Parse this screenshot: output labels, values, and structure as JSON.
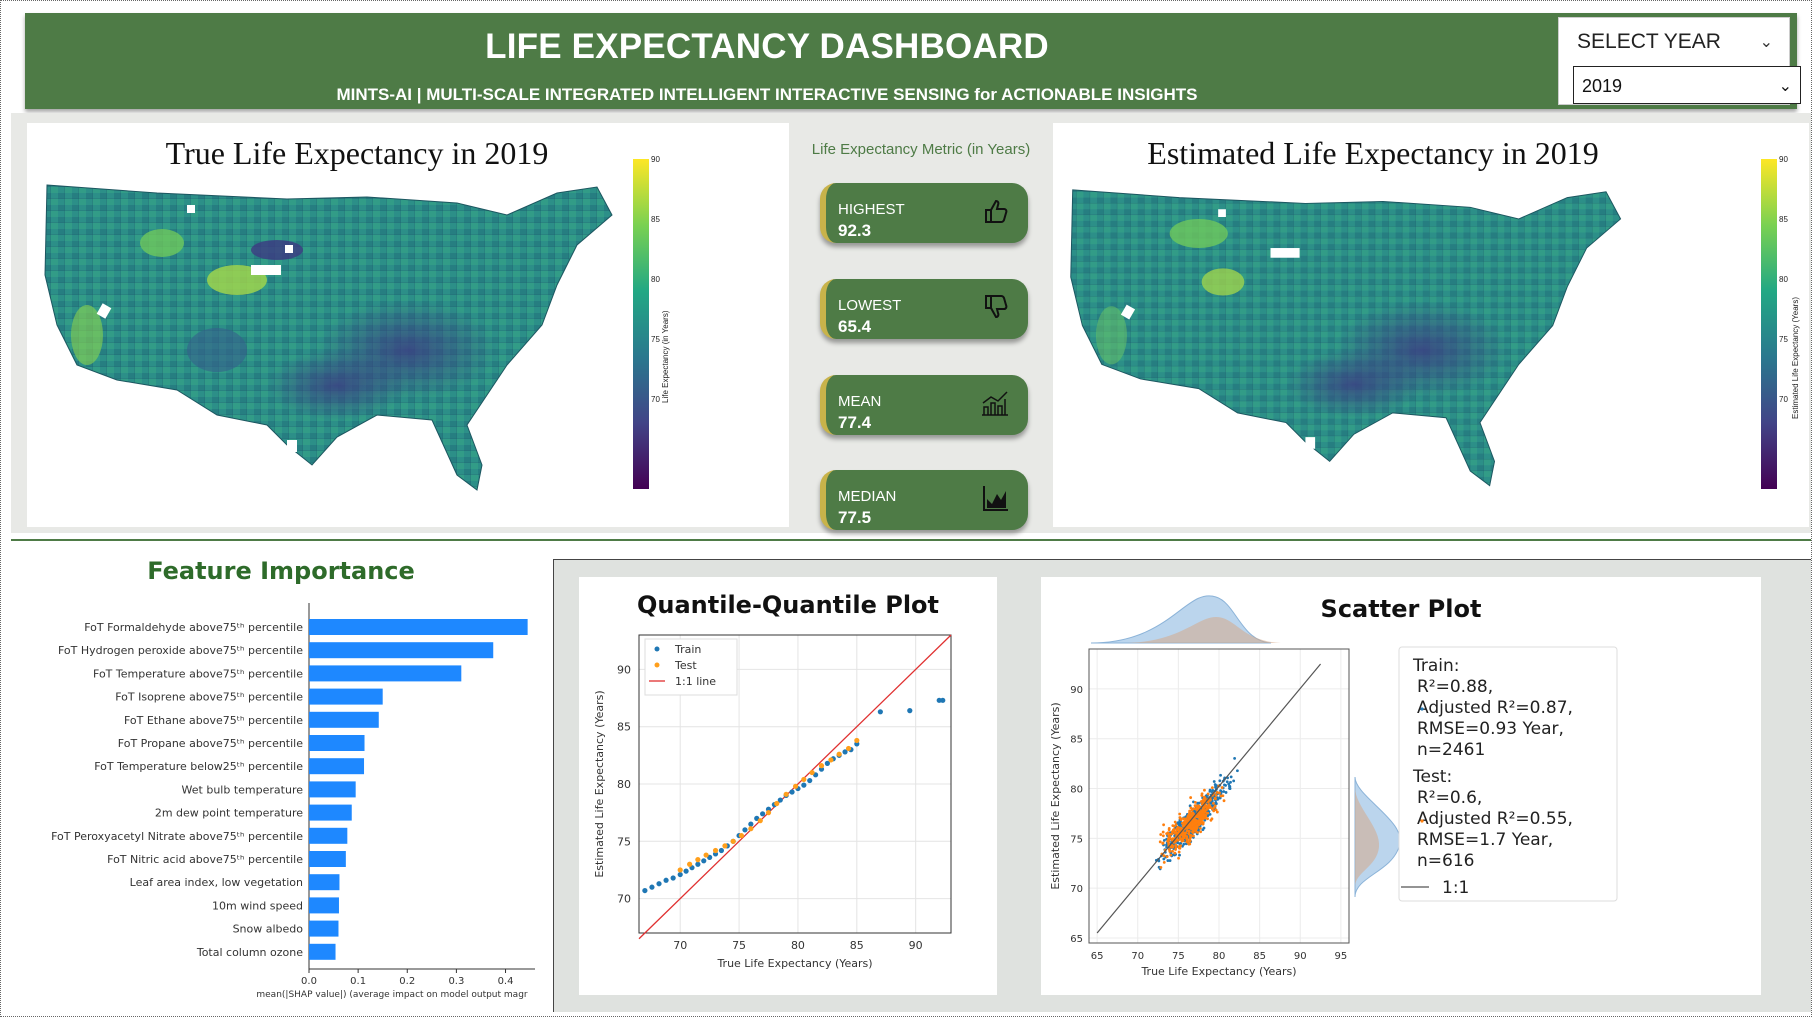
{
  "header": {
    "title": "LIFE EXPECTANCY DASHBOARD",
    "subtitle": "MINTS-AI | MULTI-SCALE INTEGRATED INTELLIGENT INTERACTIVE SENSING for ACTIONABLE INSIGHTS"
  },
  "year_filter": {
    "label": "SELECT YEAR",
    "selected": "2019"
  },
  "maps": {
    "true_title": "True Life Expectancy in 2019",
    "true_cbar_label": "Life Expectancy (in Years)",
    "est_title": "Estimated Life Expectancy in 2019",
    "est_cbar_label": "Estimated Life Expectancy (Years)",
    "cbar_ticks": [
      "90",
      "85",
      "80",
      "75",
      "70"
    ]
  },
  "metrics": {
    "title": "Life Expectancy Metric (in Years)",
    "items": [
      {
        "label": "HIGHEST",
        "value": "92.3",
        "icon": "thumbs-up-icon"
      },
      {
        "label": "LOWEST",
        "value": "65.4",
        "icon": "thumbs-down-icon"
      },
      {
        "label": "MEAN",
        "value": "77.4",
        "icon": "bar-trend-icon"
      },
      {
        "label": "MEDIAN",
        "value": "77.5",
        "icon": "area-chart-icon"
      }
    ]
  },
  "feature_importance": {
    "title": "Feature Importance",
    "chart_data": {
      "type": "bar",
      "orientation": "horizontal",
      "categories": [
        "FoT Formaldehyde above75ᵗʰ percentile",
        "FoT Hydrogen peroxide above75ᵗʰ percentile",
        "FoT Temperature above75ᵗʰ percentile",
        "FoT Isoprene above75ᵗʰ percentile",
        "FoT Ethane above75ᵗʰ percentile",
        "FoT Propane above75ᵗʰ percentile",
        "FoT Temperature below25ᵗʰ percentile",
        "Wet bulb temperature",
        "2m dew point temperature",
        "FoT Peroxyacetyl Nitrate above75ᵗʰ percentile",
        "FoT Nitric acid above75ᵗʰ percentile",
        "Leaf area index, low vegetation",
        "10m wind speed",
        "Snow albedo",
        "Total column ozone"
      ],
      "values": [
        0.445,
        0.375,
        0.31,
        0.15,
        0.142,
        0.113,
        0.112,
        0.095,
        0.087,
        0.078,
        0.075,
        0.062,
        0.061,
        0.06,
        0.054
      ],
      "xticks": [
        "0.0",
        "0.1",
        "0.2",
        "0.3",
        "0.4"
      ],
      "xlim": [
        0,
        0.46
      ],
      "xlabel": "mean(|SHAP value|) (average impact on model output magr",
      "color": "#1e88ff"
    }
  },
  "qq_plot": {
    "title": "Quantile-Quantile Plot",
    "chart_data": {
      "type": "scatter",
      "xlabel": "True Life Expectancy (Years)",
      "ylabel": "Estimated Life Expectancy (Years)",
      "xlim": [
        66.5,
        93
      ],
      "ylim": [
        67,
        93
      ],
      "xticks": [
        "70",
        "75",
        "80",
        "85",
        "90"
      ],
      "yticks": [
        "70",
        "75",
        "80",
        "85",
        "90"
      ],
      "legend": [
        "Train",
        "Test",
        "1:1 line"
      ],
      "series": [
        {
          "name": "Train",
          "color": "#1f77b4",
          "x": [
            67.0,
            67.6,
            68.2,
            68.8,
            69.4,
            70.0,
            70.5,
            71.0,
            71.5,
            72.0,
            72.5,
            73.0,
            73.5,
            74.0,
            74.5,
            75.0,
            75.5,
            76.0,
            76.5,
            77.0,
            77.5,
            78.0,
            78.5,
            79.0,
            79.5,
            80.0,
            80.5,
            81.0,
            81.5,
            82.0,
            82.5,
            83.0,
            83.5,
            84.0,
            84.5,
            85.0,
            87.0,
            89.5,
            92.0,
            92.3
          ],
          "y": [
            70.7,
            71.0,
            71.3,
            71.6,
            71.8,
            72.1,
            72.4,
            72.7,
            73.0,
            73.3,
            73.6,
            73.9,
            74.2,
            74.6,
            75.0,
            75.5,
            76.0,
            76.5,
            77.0,
            77.4,
            77.8,
            78.2,
            78.6,
            79.0,
            79.3,
            79.6,
            79.9,
            80.3,
            80.8,
            81.3,
            81.8,
            82.2,
            82.5,
            82.8,
            83.0,
            83.5,
            86.3,
            86.4,
            87.3,
            87.3
          ]
        },
        {
          "name": "Test",
          "color": "#ff9f1c",
          "x": [
            70.0,
            70.8,
            71.5,
            72.2,
            73.0,
            73.8,
            74.5,
            75.2,
            76.0,
            76.8,
            77.5,
            78.2,
            79.0,
            79.8,
            80.5,
            81.2,
            82.0,
            82.8,
            83.5,
            84.3,
            85.0
          ],
          "y": [
            72.5,
            73.0,
            73.4,
            73.8,
            74.2,
            74.6,
            75.0,
            75.5,
            76.1,
            76.8,
            77.5,
            78.3,
            79.1,
            79.8,
            80.4,
            81.0,
            81.6,
            82.1,
            82.6,
            83.1,
            83.8
          ]
        }
      ]
    }
  },
  "scatter_plot": {
    "title": "Scatter Plot",
    "chart_data": {
      "type": "scatter",
      "xlabel": "True Life Expectancy (Years)",
      "ylabel": "Estimated Life Expectancy (Years)",
      "xlim": [
        64,
        96
      ],
      "ylim": [
        64.5,
        94
      ],
      "xticks": [
        "65",
        "70",
        "75",
        "80",
        "85",
        "90",
        "95"
      ],
      "yticks": [
        "65",
        "70",
        "75",
        "80",
        "85",
        "90"
      ],
      "series": [
        {
          "name": "Train",
          "color": "#1f77b4"
        },
        {
          "name": "Test",
          "color": "#ff7f0e"
        }
      ]
    },
    "legend": {
      "train_lines": [
        "Train:",
        "R²=0.88,",
        "Adjusted R²=0.87,",
        "RMSE=0.93 Year,",
        "n=2461"
      ],
      "test_lines": [
        "Test:",
        "R²=0.6,",
        "Adjusted R²=0.55,",
        "RMSE=1.7 Year,",
        "n=616"
      ],
      "line_label": "1:1"
    }
  }
}
